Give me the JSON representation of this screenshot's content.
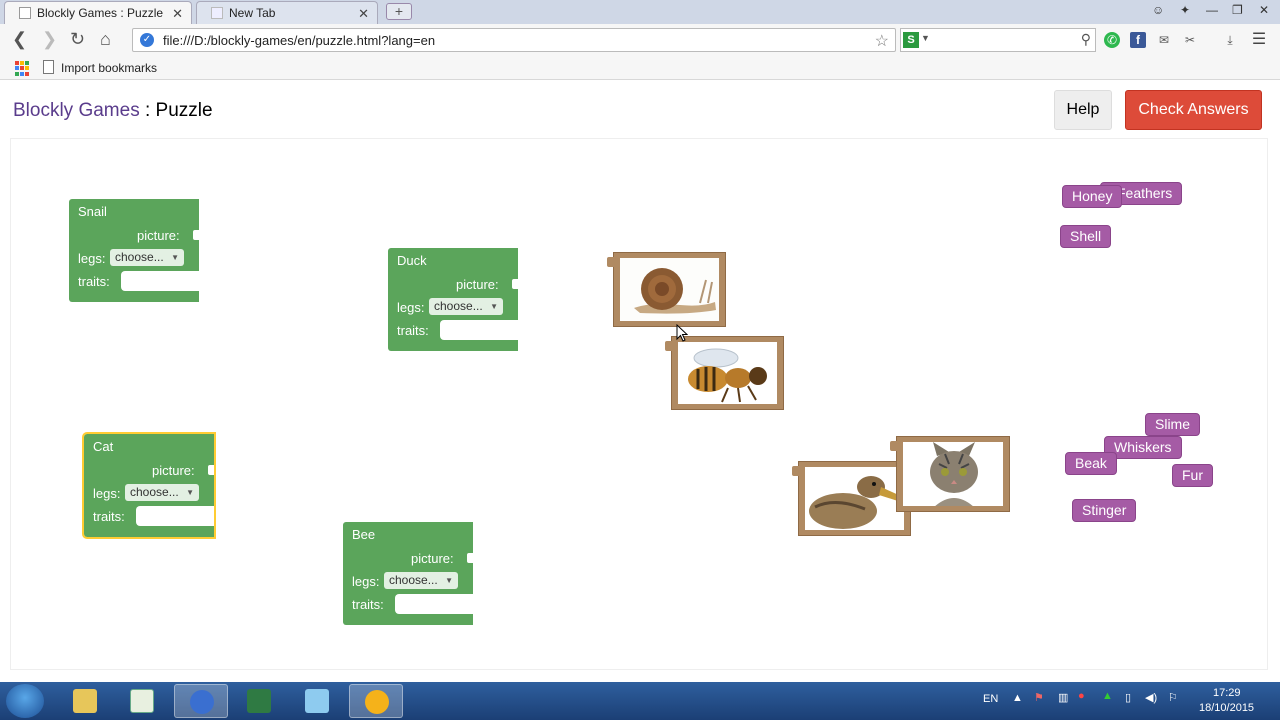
{
  "browser": {
    "tabs": [
      {
        "label": "Blockly Games : Puzzle",
        "active": true
      },
      {
        "label": "New Tab",
        "active": false
      }
    ],
    "url": "file:///D:/blockly-games/en/puzzle.html?lang=en",
    "bookmarks": [
      {
        "label": "Import bookmarks"
      }
    ]
  },
  "page": {
    "app_name": "Blockly Games",
    "separator": " : ",
    "page_name": "Puzzle",
    "help_label": "Help",
    "check_label": "Check Answers"
  },
  "animals": [
    {
      "name": "Snail",
      "picture_label": "picture:",
      "legs_label": "legs:",
      "legs_value": "choose...",
      "traits_label": "traits:"
    },
    {
      "name": "Duck",
      "picture_label": "picture:",
      "legs_label": "legs:",
      "legs_value": "choose...",
      "traits_label": "traits:"
    },
    {
      "name": "Cat",
      "picture_label": "picture:",
      "legs_label": "legs:",
      "legs_value": "choose...",
      "traits_label": "traits:"
    },
    {
      "name": "Bee",
      "picture_label": "picture:",
      "legs_label": "legs:",
      "legs_value": "choose...",
      "traits_label": "traits:"
    }
  ],
  "pictures": [
    "snail",
    "bee",
    "duck",
    "cat"
  ],
  "traits": [
    "Feathers",
    "Honey",
    "Shell",
    "Slime",
    "Whiskers",
    "Beak",
    "Fur",
    "Stinger"
  ],
  "taskbar": {
    "language": "EN",
    "time": "17:29",
    "date": "18/10/2015"
  },
  "colors": {
    "animal_block": "#5ba55b",
    "trait_block": "#a55ba5",
    "picture_block": "#b08a62",
    "check_button": "#dd4b39",
    "title_link": "#5a3c8c"
  }
}
